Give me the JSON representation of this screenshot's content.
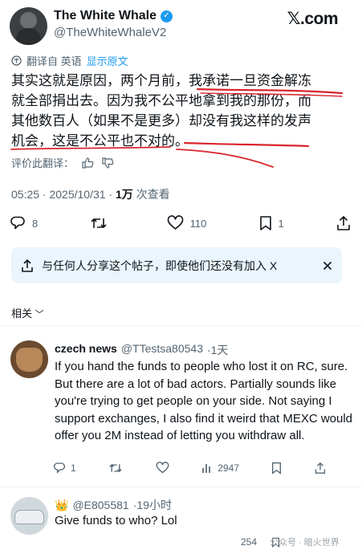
{
  "header": {
    "display_name": "The White Whale",
    "handle": "@TheWhiteWhaleV2",
    "brand": "𝕏.com"
  },
  "translation": {
    "label": "翻译自 英语",
    "show_original": "显示原文"
  },
  "tweet": {
    "lines": [
      "其实这就是原因，两个月前，我承诺一旦资金解冻",
      "就全部捐出去。因为我不公平地拿到我的那份，而",
      "其他数百人（如果不是更多）却没有我这样的发声",
      "机会，这是不公平也不对的。"
    ],
    "rate_label": "评价此翻译：",
    "time": "05:25 · 2025/10/31 · ",
    "views_count": "1万",
    "views_label": " 次查看"
  },
  "actions": {
    "replies": "8",
    "retweets": "",
    "likes": "110",
    "bookmarks": "1"
  },
  "share_banner": {
    "text": "与任何人分享这个帖子，即使他们还没有加入 X"
  },
  "related_label": "相关",
  "reply1": {
    "name": "czech news",
    "handle": "@TTestsa80543",
    "time": "·1天",
    "text": "If you hand the funds to people who lost it on RC, sure. But there are a lot of bad actors. Partially sounds like you're trying to get people on your side. Not saying I support exchanges, I also find it weird that MEXC would offer you 2M instead of letting you withdraw all.",
    "replies": "1",
    "retweets": "",
    "likes": "",
    "views": "2947"
  },
  "reply2": {
    "badge": "👑",
    "handle": "@E805581",
    "time": "·19小时",
    "text": "Give funds to who? Lol",
    "views": "254"
  },
  "watermark": "公众号 · 暗火世界",
  "colors": {
    "accent": "#1d9bf0",
    "secondary_text": "#536471",
    "underline": "#d9252e"
  }
}
